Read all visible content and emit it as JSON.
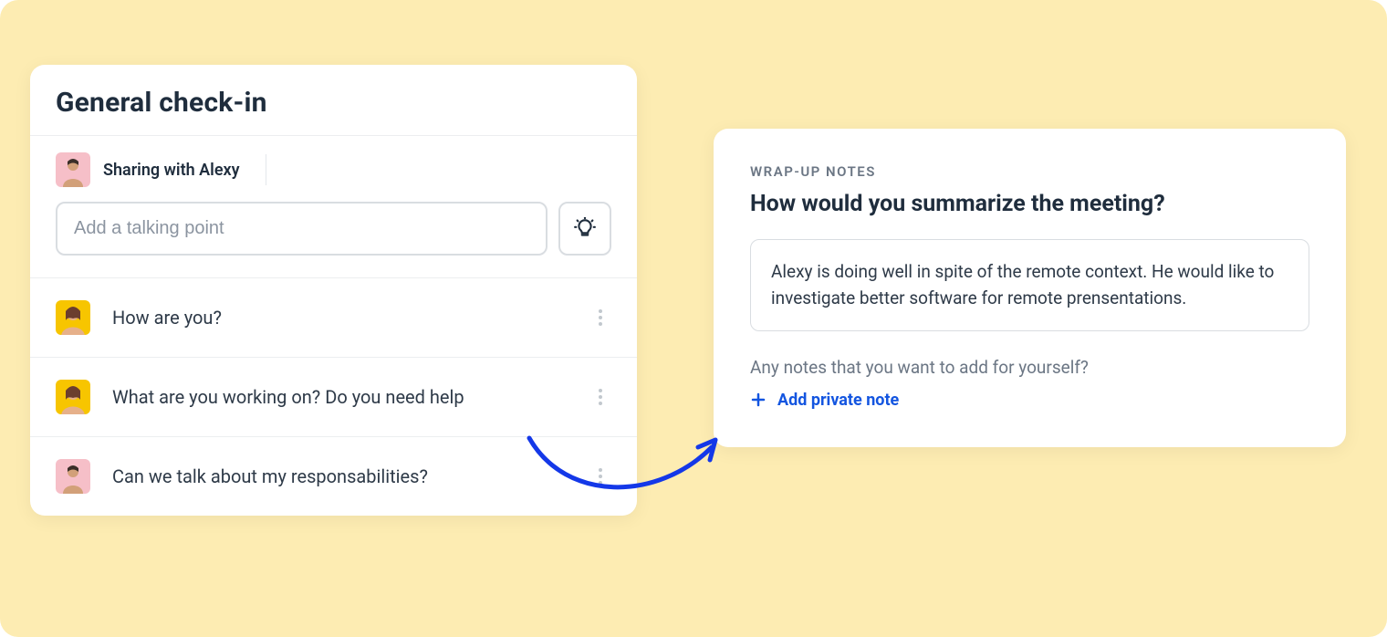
{
  "left": {
    "title": "General check-in",
    "sharing_label": "Sharing with Alexy",
    "input_placeholder": "Add a talking point",
    "items": [
      {
        "text": "How are you?",
        "avatar": "yellow"
      },
      {
        "text": "What are you working on? Do you need help",
        "avatar": "yellow"
      },
      {
        "text": "Can we talk about my responsabilities?",
        "avatar": "pink"
      }
    ]
  },
  "right": {
    "section_label": "WRAP-UP NOTES",
    "title": "How would you summarize the meeting?",
    "summary": "Alexy is doing well in spite of the remote context. He would like to investigate better software for remote prensentations.",
    "notes_prompt": "Any notes that you want to add for yourself?",
    "add_note_label": "Add private note"
  },
  "avatars": {
    "pink_bg": "#F6BFC8",
    "yellow_bg": "#F7C500"
  }
}
